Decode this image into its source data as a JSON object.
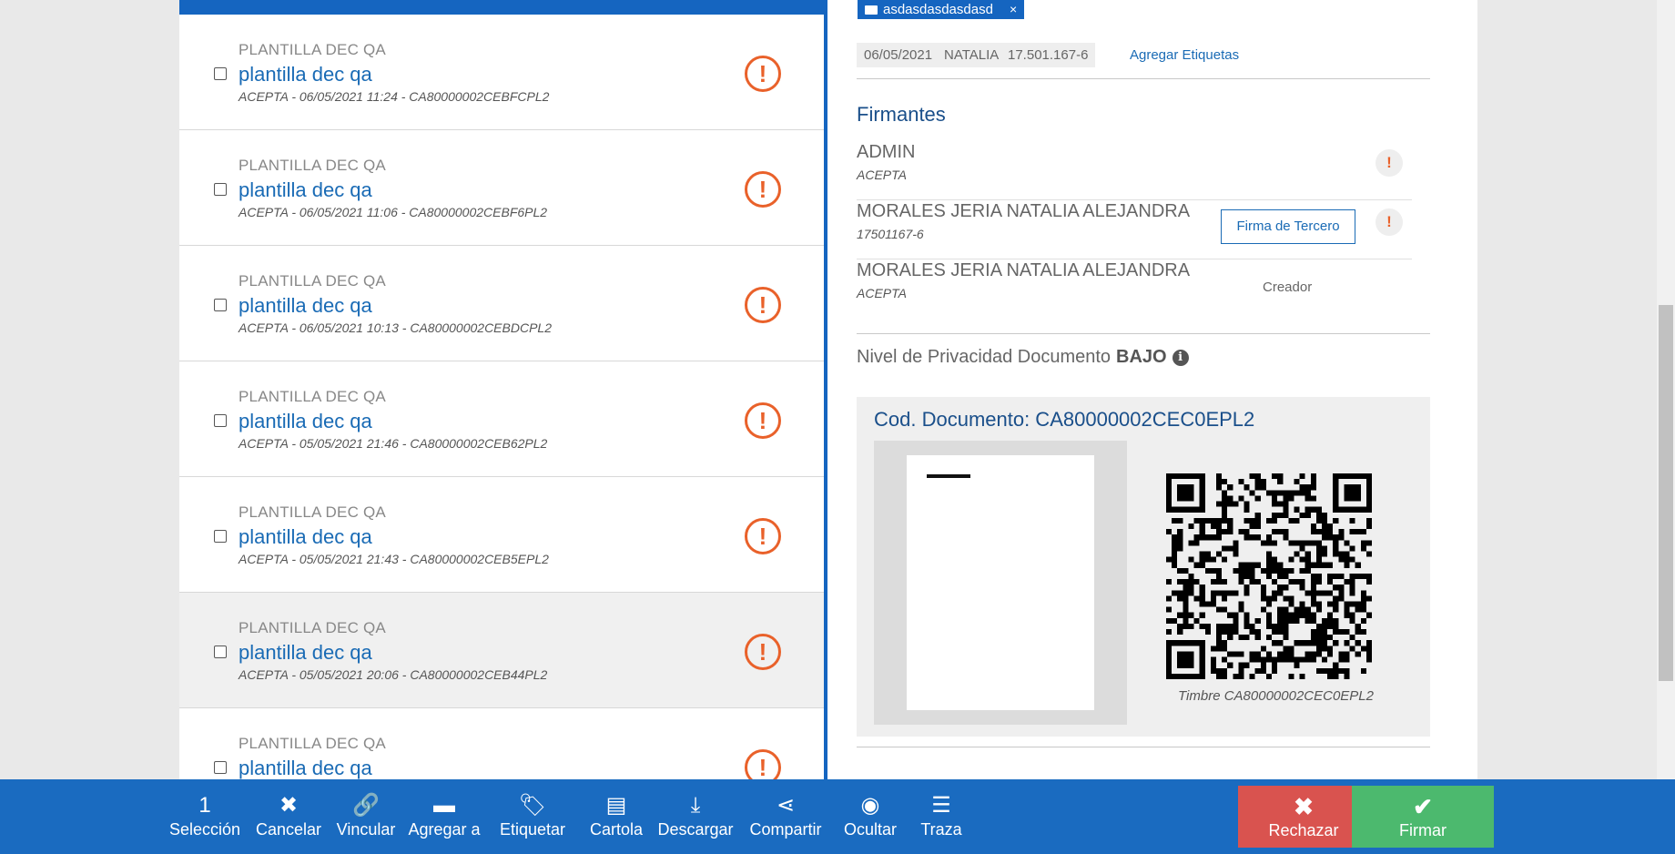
{
  "folder_tag": {
    "label": "asdasdasdasdasd",
    "close": "×",
    "icon": "folder-icon"
  },
  "chips": [
    "06/05/2021",
    "NATALIA",
    "17.501.167-6"
  ],
  "add_tags_link": "Agregar Etiquetas",
  "documents": [
    {
      "type": "PLANTILLA DEC QA",
      "title": "plantilla dec qa",
      "meta": "ACEPTA - 06/05/2021 11:24 - CA80000002CEBFCPL2",
      "alert": "!"
    },
    {
      "type": "PLANTILLA DEC QA",
      "title": "plantilla dec qa",
      "meta": "ACEPTA - 06/05/2021 11:06 - CA80000002CEBF6PL2",
      "alert": "!"
    },
    {
      "type": "PLANTILLA DEC QA",
      "title": "plantilla dec qa",
      "meta": "ACEPTA - 06/05/2021 10:13 - CA80000002CEBDCPL2",
      "alert": "!"
    },
    {
      "type": "PLANTILLA DEC QA",
      "title": "plantilla dec qa",
      "meta": "ACEPTA - 05/05/2021 21:46 - CA80000002CEB62PL2",
      "alert": "!"
    },
    {
      "type": "PLANTILLA DEC QA",
      "title": "plantilla dec qa",
      "meta": "ACEPTA - 05/05/2021 21:43 - CA80000002CEB5EPL2",
      "alert": "!"
    },
    {
      "type": "PLANTILLA DEC QA",
      "title": "plantilla dec qa",
      "meta": "ACEPTA - 05/05/2021 20:06 - CA80000002CEB44PL2",
      "alert": "!",
      "selected": true
    },
    {
      "type": "PLANTILLA DEC QA",
      "title": "plantilla dec qa",
      "meta": "",
      "alert": "!"
    }
  ],
  "signers_title": "Firmantes",
  "signers": [
    {
      "name": "ADMIN",
      "sub": "ACEPTA",
      "alert": "!"
    },
    {
      "name": "MORALES JERIA NATALIA ALEJANDRA",
      "sub": "17501167-6",
      "button": "Firma de Tercero",
      "alert": "!"
    },
    {
      "name": "MORALES JERIA NATALIA ALEJANDRA",
      "sub": "ACEPTA",
      "role": "Creador"
    }
  ],
  "privacy": {
    "label": "Nivel de Privacidad Documento",
    "level": "BAJO",
    "info": "i"
  },
  "code": {
    "title": "Cod. Documento: CA80000002CEC0EPL2",
    "caption": "Timbre CA80000002CEC0EPL2"
  },
  "toolbar": [
    {
      "icon": "1",
      "label": "Selección",
      "name": "selection-count"
    },
    {
      "icon": "✖",
      "label": "Cancelar",
      "name": "cancel"
    },
    {
      "icon": "🔗",
      "label": "Vincular",
      "name": "link"
    },
    {
      "icon": "▬",
      "label": "Agregar a",
      "name": "add-to"
    },
    {
      "icon": "🏷",
      "label": "Etiquetar",
      "name": "tag"
    },
    {
      "icon": "▤",
      "label": "Cartola",
      "name": "statement"
    },
    {
      "icon": "⤓",
      "label": "Descargar",
      "name": "download"
    },
    {
      "icon": "⋖",
      "label": "Compartir",
      "name": "share"
    },
    {
      "icon": "◉",
      "label": "Ocultar",
      "name": "hide"
    },
    {
      "icon": "☰",
      "label": "Traza",
      "name": "trace"
    }
  ],
  "reject": {
    "icon": "✖",
    "label": "Rechazar",
    "color": "#d9534f"
  },
  "sign": {
    "icon": "✔",
    "label": "Firmar",
    "color": "#4cb96e"
  }
}
